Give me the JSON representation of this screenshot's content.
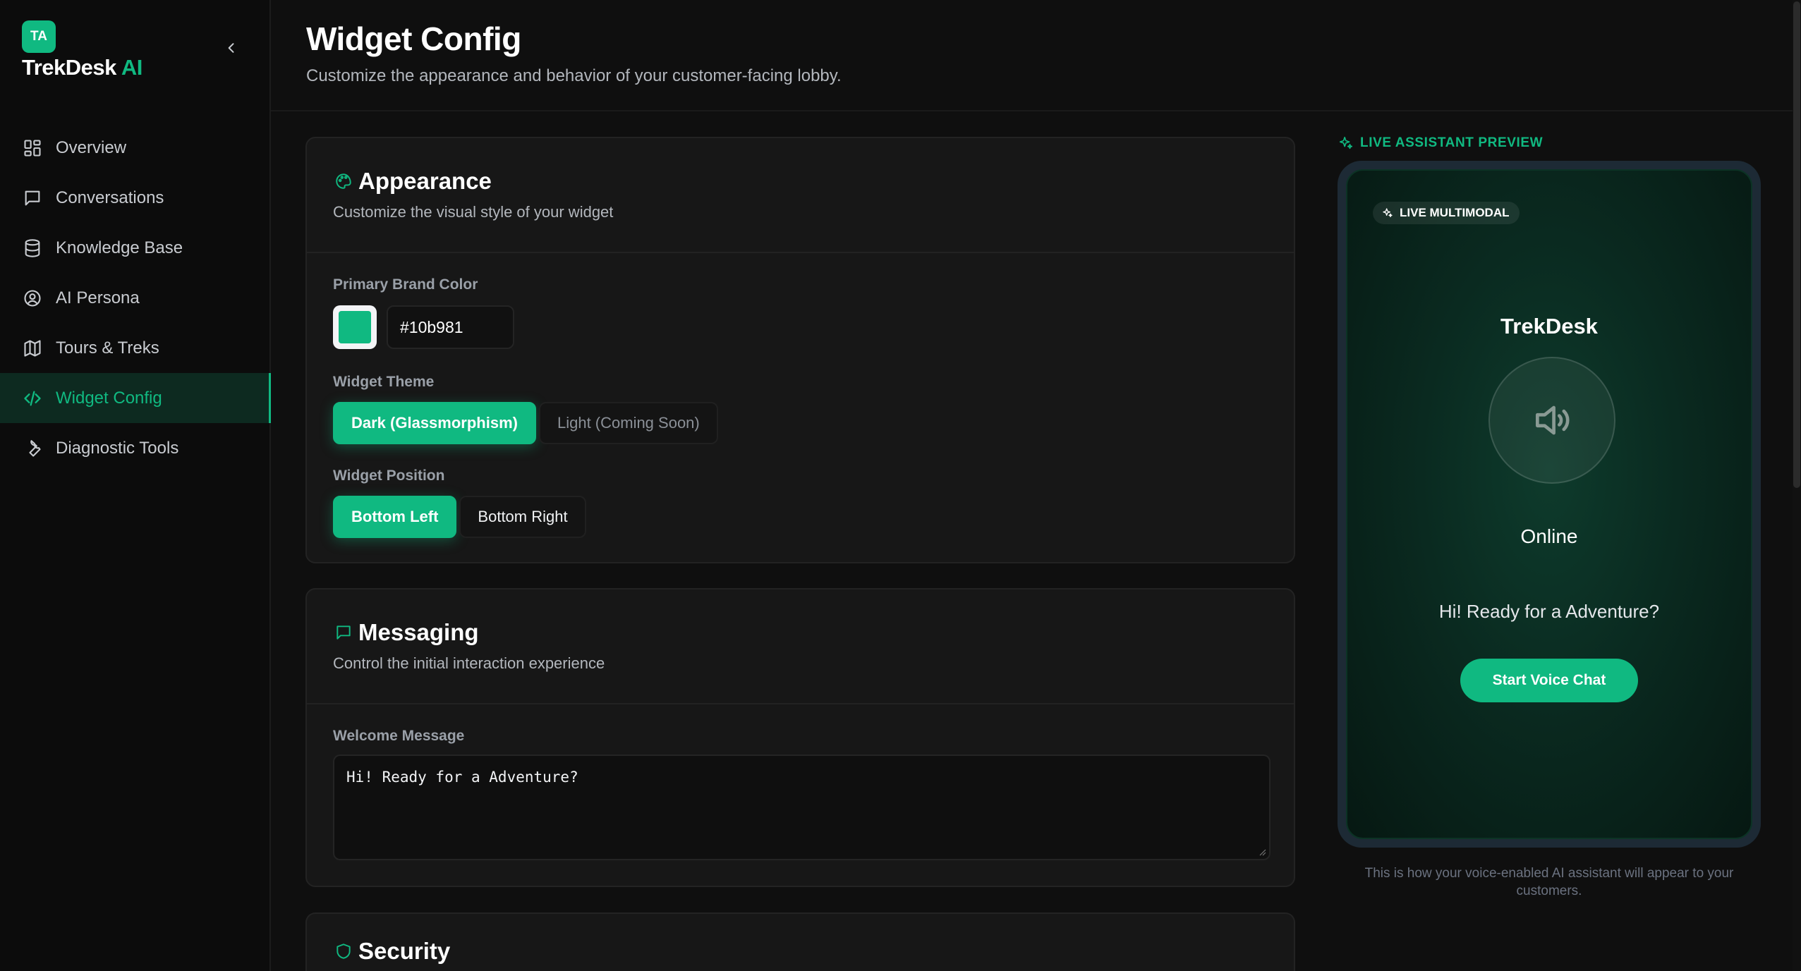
{
  "sidebar": {
    "badge": "TA",
    "brand_main": "TrekDesk",
    "brand_accent": "AI",
    "items": [
      {
        "label": "Overview",
        "icon": "grid-icon"
      },
      {
        "label": "Conversations",
        "icon": "chat-icon"
      },
      {
        "label": "Knowledge Base",
        "icon": "database-icon"
      },
      {
        "label": "AI Persona",
        "icon": "user-circle-icon"
      },
      {
        "label": "Tours & Treks",
        "icon": "map-icon"
      },
      {
        "label": "Widget Config",
        "icon": "code-icon",
        "active": true
      },
      {
        "label": "Diagnostic Tools",
        "icon": "wrench-icon"
      }
    ]
  },
  "header": {
    "title": "Widget Config",
    "subtitle": "Customize the appearance and behavior of your customer-facing lobby."
  },
  "appearance": {
    "title": "Appearance",
    "description": "Customize the visual style of your widget",
    "brand_color_label": "Primary Brand Color",
    "brand_color_value": "#10b981",
    "theme_label": "Widget Theme",
    "theme_options": [
      "Dark (Glassmorphism)",
      "Light (Coming Soon)"
    ],
    "theme_selected": "Dark (Glassmorphism)",
    "position_label": "Widget Position",
    "position_options": [
      "Bottom Left",
      "Bottom Right"
    ],
    "position_selected": "Bottom Left"
  },
  "messaging": {
    "title": "Messaging",
    "description": "Control the initial interaction experience",
    "welcome_label": "Welcome Message",
    "welcome_value": "Hi! Ready for a Adventure?"
  },
  "security": {
    "title": "Security"
  },
  "preview": {
    "label": "LIVE ASSISTANT PREVIEW",
    "chip": "LIVE MULTIMODAL",
    "brand": "TrekDesk",
    "status": "Online",
    "welcome": "Hi! Ready for a Adventure?",
    "start_button": "Start Voice Chat",
    "caption": "This is how your voice-enabled AI assistant will appear to your customers."
  },
  "colors": {
    "accent": "#10b981",
    "background": "#0f0f0f",
    "card": "#171717"
  }
}
